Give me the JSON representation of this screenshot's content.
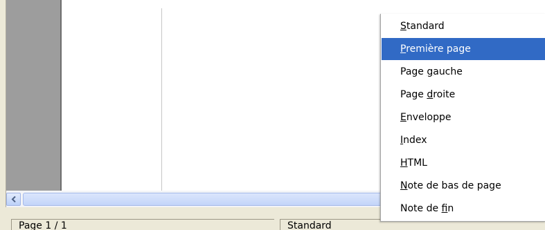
{
  "menu": {
    "selected_index": 1,
    "items": [
      {
        "pre": "",
        "mnemonic": "S",
        "post": "tandard"
      },
      {
        "pre": "",
        "mnemonic": "P",
        "post": "remière page"
      },
      {
        "pre": "Page ",
        "mnemonic": "g",
        "post": "auche"
      },
      {
        "pre": "Page ",
        "mnemonic": "d",
        "post": "roite"
      },
      {
        "pre": "",
        "mnemonic": "E",
        "post": "nveloppe"
      },
      {
        "pre": "",
        "mnemonic": "I",
        "post": "ndex"
      },
      {
        "pre": "",
        "mnemonic": "H",
        "post": "TML"
      },
      {
        "pre": "",
        "mnemonic": "N",
        "post": "ote de bas de page"
      },
      {
        "pre": "Note de ",
        "mnemonic": "f",
        "post": "in"
      }
    ]
  },
  "statusbar": {
    "page": "Page 1 / 1",
    "page_style": "Standard"
  },
  "colors": {
    "selection": "#316ac5",
    "margin_gray": "#9d9d9d",
    "statusbar_bg": "#ece9d8"
  }
}
